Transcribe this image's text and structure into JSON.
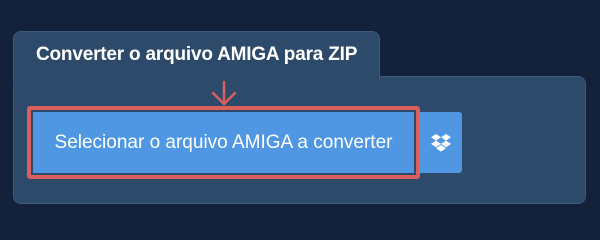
{
  "converter": {
    "title": "Converter o arquivo AMIGA para ZIP",
    "select_button_label": "Selecionar o arquivo AMIGA a converter",
    "dropbox_icon": "dropbox-icon",
    "arrow_icon": "arrow-down-icon"
  },
  "colors": {
    "page_background": "#13223a",
    "panel_background": "#2d4a6b",
    "button_blue": "#4f97e3",
    "highlight_red": "#d9605c"
  }
}
